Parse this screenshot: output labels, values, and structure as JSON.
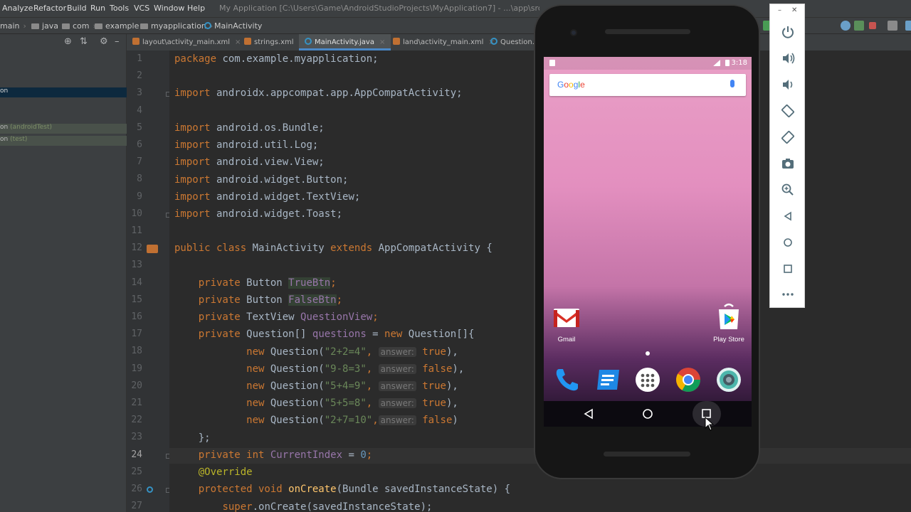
{
  "menu": {
    "items": [
      "Analyze",
      "Refactor",
      "Build",
      "Run",
      "Tools",
      "VCS",
      "Window",
      "Help"
    ],
    "window_title": "My Application [C:\\Users\\Game\\AndroidStudioProjects\\MyApplication7] - ...\\app\\src\\main\\java\\com"
  },
  "breadcrumb": [
    "main",
    "java",
    "com",
    "example",
    "myapplication",
    "MainActivity"
  ],
  "project_panel": {
    "selected_row": "on",
    "rows": [
      {
        "name": "on",
        "qualifier": "(androidTest)"
      },
      {
        "name": "on",
        "qualifier": "(test)"
      }
    ]
  },
  "tabs": [
    {
      "label": "layout\\activity_main.xml",
      "active": false
    },
    {
      "label": "strings.xml",
      "active": false
    },
    {
      "label": "MainActivity.java",
      "active": true
    },
    {
      "label": "land\\activity_main.xml",
      "active": false
    },
    {
      "label": "Question.j",
      "active": false
    }
  ],
  "editor": {
    "current_line": 24,
    "line_numbers": [
      1,
      2,
      3,
      4,
      5,
      6,
      7,
      8,
      9,
      10,
      11,
      12,
      13,
      14,
      15,
      16,
      17,
      18,
      19,
      20,
      21,
      22,
      23,
      24,
      25,
      26,
      27
    ],
    "code": {
      "l1_kw": "package",
      "l1_rest": " com.example.myapplication;",
      "l3_kw": "import",
      "l3_rest": " androidx.appcompat.app.AppCompatActivity;",
      "l5_kw": "import",
      "l5_rest": " android.os.Bundle;",
      "l6_kw": "import",
      "l6_rest": " android.util.Log;",
      "l7_kw": "import",
      "l7_rest": " android.view.View;",
      "l8_kw": "import",
      "l8_rest": " android.widget.Button;",
      "l9_kw": "import",
      "l9_rest": " android.widget.TextView;",
      "l10_kw": "import",
      "l10_rest": " android.widget.Toast;",
      "l12_kw1": "public class",
      "l12_name": " MainActivity ",
      "l12_kw2": "extends",
      "l12_rest": " AppCompatActivity {",
      "l14_kw": "private",
      "l14_type": " Button ",
      "l14_field": "TrueBtn",
      "l14_end": ";",
      "l15_kw": "private",
      "l15_type": " Button ",
      "l15_field": "FalseBtn",
      "l15_end": ";",
      "l16_kw": "private",
      "l16_type": " TextView ",
      "l16_field": "QuestionView",
      "l16_end": ";",
      "l17_kw": "private",
      "l17_type": " Question[] ",
      "l17_field": "questions",
      "l17_eq": " = ",
      "l17_new": "new",
      "l17_rest": " Question[]{",
      "q_new": "new",
      "q_ctor": " Question(",
      "q_hint": "answer:",
      "questions": [
        {
          "str": "\"2+2=4\"",
          "bool": "true",
          "end": "),"
        },
        {
          "str": "\"9-8=3\"",
          "bool": "false",
          "end": "),"
        },
        {
          "str": "\"5+4=9\"",
          "bool": "true",
          "end": "),"
        },
        {
          "str": "\"5+5=8\"",
          "bool": "true",
          "end": "),"
        },
        {
          "str": "\"2+7=10\"",
          "bool": "false",
          "end": ")"
        }
      ],
      "l23": "};",
      "l24_kw": "private int",
      "l24_field": " CurrentIndex",
      "l24_eq": " = ",
      "l24_num": "0",
      "l24_end": ";",
      "l25": "@Override",
      "l26_kw": "protected void",
      "l26_mth": " onCreate",
      "l26_rest": "(Bundle savedInstanceState) {",
      "l27_kw": "super",
      "l27_rest": ".onCreate(savedInstanceState);"
    }
  },
  "phone": {
    "time": "3:18",
    "search_logo": "Google",
    "apps": [
      {
        "label": "Gmail"
      },
      {
        "label": "Play Store"
      }
    ]
  },
  "colors": {
    "accent": "#4a88c7",
    "keyword": "#cc7832",
    "field": "#9876aa",
    "string": "#6a8759",
    "number": "#6897bb",
    "annotation": "#bbb529"
  }
}
